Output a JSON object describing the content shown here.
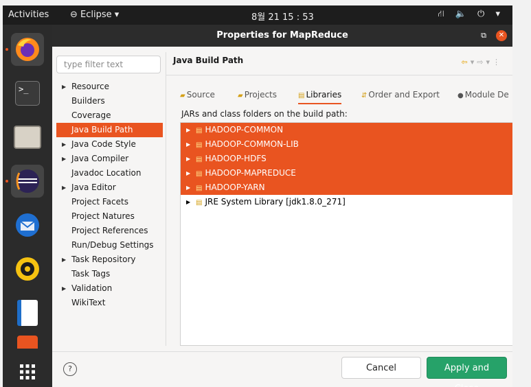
{
  "topbar": {
    "activities": "Activities",
    "app": "Eclipse",
    "clock": "8월 21 15 : 53",
    "tray": "⛙ 🔈 ⏻ ▾"
  },
  "dock": {
    "items": [
      {
        "icon": "firefox-icon",
        "label": "Firefox"
      },
      {
        "icon": "terminal-icon",
        "label": "Terminal"
      },
      {
        "icon": "files-icon",
        "label": "Files"
      },
      {
        "icon": "eclipse-icon",
        "label": "Eclipse"
      },
      {
        "icon": "thunderbird-icon",
        "label": "Thunderbird"
      },
      {
        "icon": "rhythmbox-icon",
        "label": "Rhythmbox"
      },
      {
        "icon": "writer-icon",
        "label": "Writer"
      },
      {
        "icon": "software-icon",
        "label": "Software"
      },
      {
        "icon": "app-grid-icon",
        "label": "Show Applications"
      }
    ]
  },
  "dialog": {
    "title": "Properties for MapReduce",
    "restore_glyph": "⧉",
    "close_glyph": "✕",
    "filter_placeholder": "type filter text",
    "tree": [
      {
        "label": "Resource",
        "expandable": true
      },
      {
        "label": "Builders",
        "expandable": false
      },
      {
        "label": "Coverage",
        "expandable": false
      },
      {
        "label": "Java Build Path",
        "expandable": false,
        "selected": true
      },
      {
        "label": "Java Code Style",
        "expandable": true
      },
      {
        "label": "Java Compiler",
        "expandable": true
      },
      {
        "label": "Javadoc Location",
        "expandable": false
      },
      {
        "label": "Java Editor",
        "expandable": true
      },
      {
        "label": "Project Facets",
        "expandable": false
      },
      {
        "label": "Project Natures",
        "expandable": false
      },
      {
        "label": "Project References",
        "expandable": false
      },
      {
        "label": "Run/Debug Settings",
        "expandable": false
      },
      {
        "label": "Task Repository",
        "expandable": true
      },
      {
        "label": "Task Tags",
        "expandable": false
      },
      {
        "label": "Validation",
        "expandable": true
      },
      {
        "label": "WikiText",
        "expandable": false
      }
    ],
    "section_title": "Java Build Path",
    "tabs": [
      {
        "label": "Source"
      },
      {
        "label": "Projects"
      },
      {
        "label": "Libraries",
        "active": true
      },
      {
        "label": "Order and Export"
      },
      {
        "label": "Module De"
      }
    ],
    "jars_label": "JARs and class folders on the build path:",
    "libraries": [
      {
        "label": "HADOOP-COMMON",
        "selected": true
      },
      {
        "label": "HADOOP-COMMON-LIB",
        "selected": true
      },
      {
        "label": "HADOOP-HDFS",
        "selected": true
      },
      {
        "label": "HADOOP-MAPREDUCE",
        "selected": true
      },
      {
        "label": "HADOOP-YARN",
        "selected": true
      },
      {
        "label": "JRE System Library [jdk1.8.0_271]",
        "selected": false
      }
    ],
    "help_glyph": "?",
    "cancel_label": "Cancel",
    "apply_label": "Apply and Close"
  },
  "colors": {
    "accent": "#e95420",
    "apply": "#26a269",
    "titlebar": "#2c2c2c",
    "dock": "#2b2b2b"
  }
}
